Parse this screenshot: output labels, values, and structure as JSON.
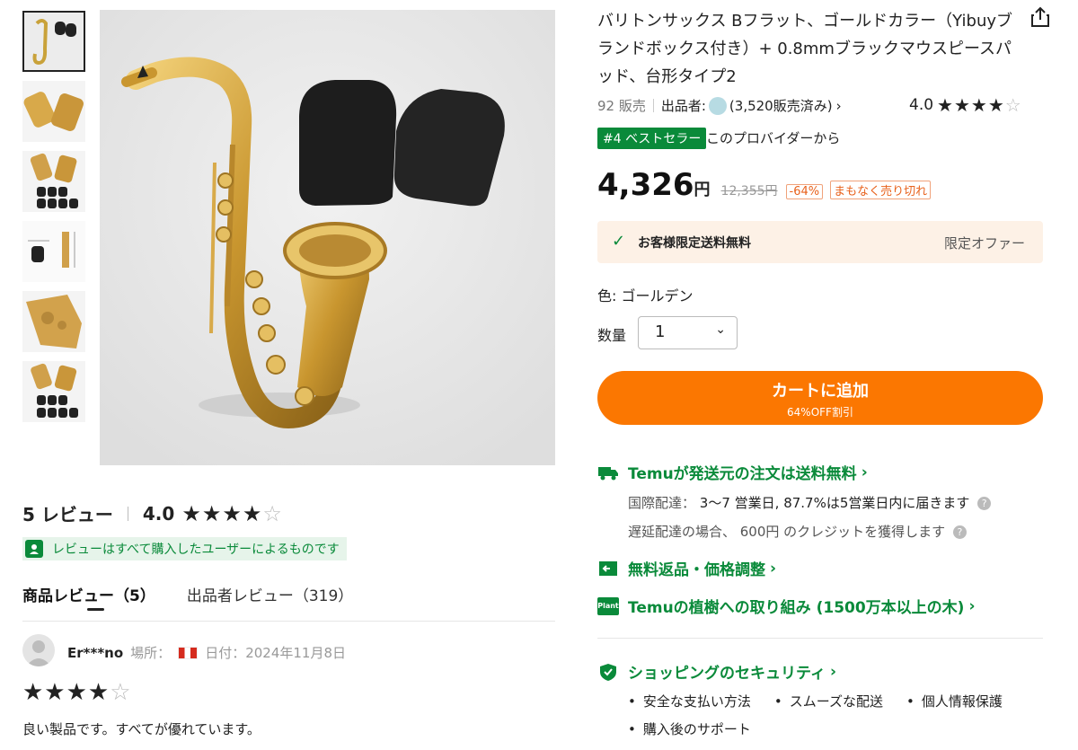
{
  "product": {
    "title": "バリトンサックス Bフラット、ゴールドカラー（Yibuyブランドボックス付き）+ 0.8mmブラックマウスピースパッド、台形タイプ2",
    "sold": "92 販売",
    "seller_label": "出品者:",
    "seller_sold": "(3,520販売済み)",
    "rating": "4.0",
    "best_badge": "#4 ベストセラー",
    "best_text": "このプロバイダーから",
    "price": "4,326",
    "yen": "円",
    "orig_price": "12,355円",
    "discount": "-64%",
    "soldout_tag": "まもなく売り切れ"
  },
  "shipping_box": {
    "text": "お客様限定送料無料",
    "offer": "限定オファー"
  },
  "options": {
    "color": "色: ゴールデン",
    "qty_label": "数量",
    "qty_value": "1"
  },
  "cart": {
    "label": "カートに追加",
    "sub": "64%OFF割引"
  },
  "info": {
    "ship_title": "Temuが発送元の注文は送料無料",
    "intl_label": "国際配達：",
    "intl_value": "3〜7 営業日, 87.7%は5営業日内に届きます",
    "delay": "遅延配達の場合、 600円 のクレジットを獲得します",
    "returns": "無料返品・価格調整",
    "plant_badge": "Plant",
    "plant": "Temuの植樹への取り組み (1500万本以上の木)",
    "security": "ショッピングのセキュリティ",
    "bullets": [
      "安全な支払い方法",
      "スムーズな配送",
      "個人情報保護",
      "購入後のサポート"
    ]
  },
  "reviews": {
    "count": "5 レビュー",
    "rating": "4.0",
    "verified": "レビューはすべて購入したユーザーによるものです",
    "tab_product": "商品レビュー（5）",
    "tab_seller": "出品者レビュー（319）",
    "item": {
      "user": "Er***no",
      "location_label": "場所：",
      "date": "日付：2024年11月8日",
      "text": "良い製品です。すべてが優れています。"
    }
  },
  "colors": {
    "accent": "#fb7701",
    "green": "#0a8a3a"
  }
}
